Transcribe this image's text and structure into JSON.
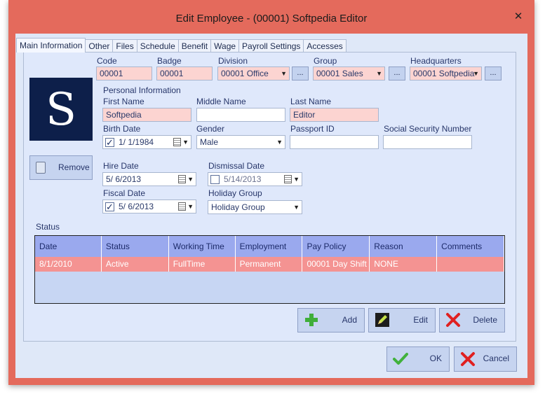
{
  "window": {
    "title": "Edit Employee - (00001) Softpedia Editor",
    "close_glyph": "✕"
  },
  "tabs": [
    "Main Information",
    "Other",
    "Files",
    "Schedule",
    "Benefit",
    "Wage",
    "Payroll Settings",
    "Accesses"
  ],
  "active_tab": "Main Information",
  "fields": {
    "code": {
      "label": "Code",
      "value": "00001"
    },
    "badge": {
      "label": "Badge",
      "value": "00001"
    },
    "division": {
      "label": "Division",
      "value": "00001  Office"
    },
    "group": {
      "label": "Group",
      "value": "00001  Sales"
    },
    "headquarters": {
      "label": "Headquarters",
      "value": "00001  Softpedia"
    },
    "browse_label": "..."
  },
  "personal": {
    "section_label": "Personal Information",
    "first_name": {
      "label": "First Name",
      "value": "Softpedia"
    },
    "middle_name": {
      "label": "Middle Name",
      "value": ""
    },
    "last_name": {
      "label": "Last Name",
      "value": "Editor"
    },
    "birth_date": {
      "label": "Birth Date",
      "value": "1/  1/1984",
      "checked": true
    },
    "gender": {
      "label": "Gender",
      "value": "Male"
    },
    "passport_id": {
      "label": "Passport ID",
      "value": ""
    },
    "ssn": {
      "label": "Social Security Number",
      "value": ""
    }
  },
  "photo": {
    "letter": "S",
    "remove_label": "Remove"
  },
  "employment": {
    "hire_date": {
      "label": "Hire Date",
      "value": "5/  6/2013"
    },
    "dismissal_date": {
      "label": "Dismissal Date",
      "value": "5/14/2013",
      "checked": false
    },
    "fiscal_date": {
      "label": "Fiscal Date",
      "value": "5/  6/2013",
      "checked": true
    },
    "holiday_group": {
      "label": "Holiday Group",
      "value": "Holiday Group"
    }
  },
  "status": {
    "label": "Status",
    "columns": [
      "Date",
      "Status",
      "Working Time",
      "Employment",
      "Pay Policy",
      "Reason",
      "Comments"
    ],
    "rows": [
      [
        "8/1/2010",
        "Active",
        "FullTime",
        "Permanent",
        "00001   Day Shift",
        "NONE",
        ""
      ]
    ]
  },
  "actions": {
    "add": "Add",
    "edit": "Edit",
    "delete": "Delete"
  },
  "footer": {
    "ok": "OK",
    "cancel": "Cancel"
  },
  "colors": {
    "frame": "#e46a5c",
    "selected_row": "#f49392",
    "header": "#9aa9ee",
    "input_highlight": "#fcd4d1"
  }
}
